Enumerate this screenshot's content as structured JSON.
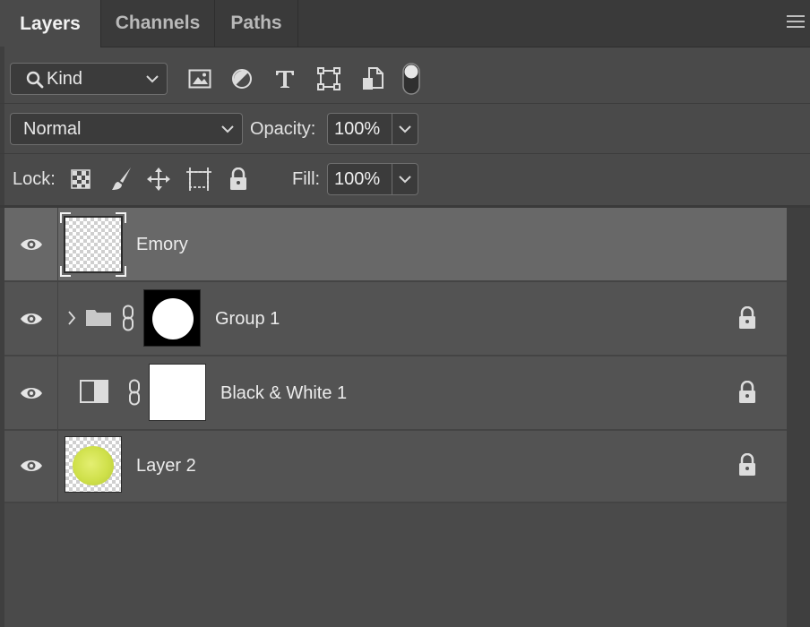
{
  "tabs": [
    {
      "label": "Layers",
      "active": true
    },
    {
      "label": "Channels",
      "active": false
    },
    {
      "label": "Paths",
      "active": false
    }
  ],
  "filter": {
    "kind_label": "Kind",
    "filter_icons": [
      "image-filter-icon",
      "adjustment-filter-icon",
      "type-filter-icon",
      "shape-filter-icon",
      "smart-object-filter-icon",
      "filter-toggle-icon"
    ]
  },
  "blend": {
    "mode": "Normal",
    "opacity_label": "Opacity:",
    "opacity_value": "100%"
  },
  "lock": {
    "label": "Lock:",
    "icons": [
      "lock-transparent-pixels-icon",
      "lock-image-pixels-icon",
      "lock-position-icon",
      "lock-artboard-icon",
      "lock-all-icon"
    ],
    "fill_label": "Fill:",
    "fill_value": "100%"
  },
  "layers": [
    {
      "name": "Emory",
      "type": "text",
      "selected": true,
      "locked": false
    },
    {
      "name": "Group 1",
      "type": "group",
      "selected": false,
      "locked": true
    },
    {
      "name": "Black & White 1",
      "type": "adjustment",
      "selected": false,
      "locked": true
    },
    {
      "name": "Layer 2",
      "type": "pixel",
      "selected": false,
      "locked": true
    }
  ],
  "colors": {
    "panel_bg": "#4a4a4a",
    "layer_bg": "#535353",
    "selected_bg": "#686868",
    "tennis_ball": "#cfe04a"
  }
}
